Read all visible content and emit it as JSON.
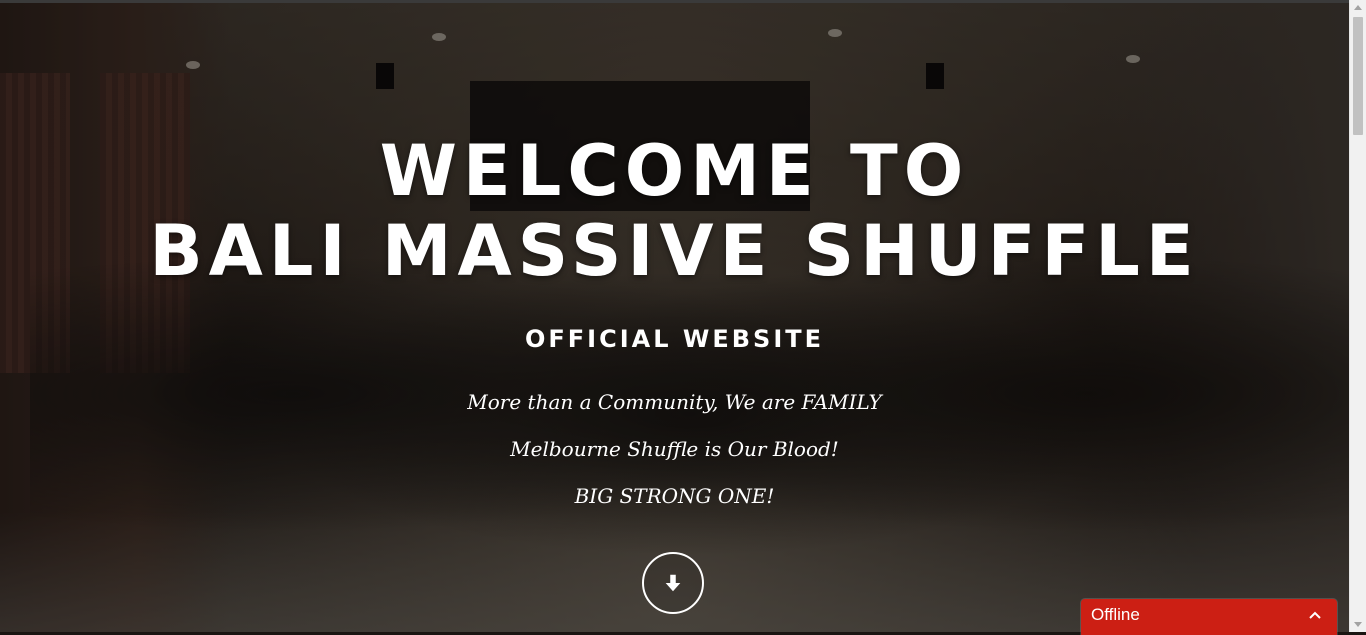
{
  "hero": {
    "title_line1": "WELCOME TO",
    "title_line2": "BALI MASSIVE SHUFFLE",
    "subtitle": "OFFICIAL WEBSITE",
    "taglines": [
      "More than a Community, We are FAMILY",
      "Melbourne Shuffle is Our Blood!",
      "BIG STRONG ONE!"
    ],
    "scroll_icon": "arrow-down-icon"
  },
  "chat": {
    "status_label": "Offline",
    "toggle_icon": "chevron-up-icon",
    "color": "#cc1f14"
  }
}
